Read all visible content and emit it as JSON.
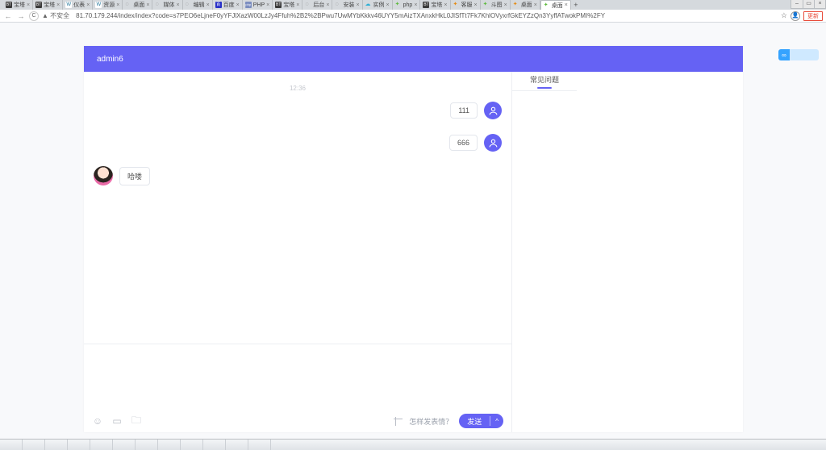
{
  "window_controls": {
    "min": "–",
    "max": "▭",
    "close": "×"
  },
  "tabs": [
    {
      "label": "宝塔",
      "fav": "bt"
    },
    {
      "label": "宝塔",
      "fav": "bt"
    },
    {
      "label": "仪表",
      "fav": "wp"
    },
    {
      "label": "资源",
      "fav": "wp"
    },
    {
      "label": "桌面",
      "fav": "globe"
    },
    {
      "label": "媒体",
      "fav": "globe"
    },
    {
      "label": "编辑",
      "fav": "globe"
    },
    {
      "label": "百度",
      "fav": "baidu"
    },
    {
      "label": "PHP",
      "fav": "php"
    },
    {
      "label": "宝塔",
      "fav": "bt"
    },
    {
      "label": "后台",
      "fav": "globe"
    },
    {
      "label": "安装",
      "fav": "globe"
    },
    {
      "label": "实例",
      "fav": "cloud"
    },
    {
      "label": "php",
      "fav": "dash"
    },
    {
      "label": "宝塔",
      "fav": "bt"
    },
    {
      "label": "客服",
      "fav": "cat"
    },
    {
      "label": "斗图",
      "fav": "dash"
    },
    {
      "label": "桌面",
      "fav": "cat"
    },
    {
      "label": "桌面",
      "fav": "dash",
      "active": true
    }
  ],
  "new_tab": "+",
  "address": {
    "back": "←",
    "fwd": "→",
    "reload": "C",
    "insecure": "▲ 不安全",
    "url": "81.70.179.244/index/index?code=s7PEO6eLjneF0yYFJlXazW00LzJy4Ffuh%2B2%2BPwu7UwMYbKkkv46UYY5mAizTXAnxkHkL0JlSfTt7Fk7KhlOVyxrfGkEYZzQn3YyffATwokPMI%2FY",
    "star": "☆",
    "user": "👤",
    "update": "更新"
  },
  "badge": {
    "icon": "∞"
  },
  "chat": {
    "header": "admin6",
    "time": "12:36",
    "messages": [
      {
        "side": "right",
        "text": "111"
      },
      {
        "side": "right",
        "text": "666"
      },
      {
        "side": "left",
        "text": "哈喽"
      }
    ],
    "toolbar": {
      "emoji": "☺",
      "image": "▭",
      "folder": "🗀",
      "crop": "",
      "hint": "怎样发表情？"
    },
    "send": {
      "label": "发送",
      "chev": "^"
    }
  },
  "faq": {
    "tab": "常见问题"
  }
}
